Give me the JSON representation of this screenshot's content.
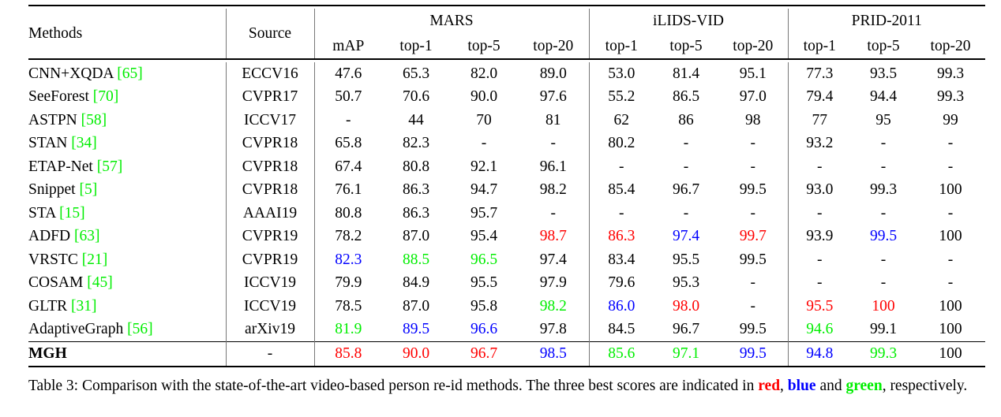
{
  "table": {
    "columns": {
      "methods_label": "Methods",
      "source_label": "Source",
      "groups": [
        {
          "name": "MARS",
          "subcols": [
            "mAP",
            "top-1",
            "top-5",
            "top-20"
          ]
        },
        {
          "name": "iLIDS-VID",
          "subcols": [
            "top-1",
            "top-5",
            "top-20"
          ]
        },
        {
          "name": "PRID-2011",
          "subcols": [
            "top-1",
            "top-5",
            "top-20"
          ]
        }
      ]
    },
    "rows": [
      {
        "method": "CNN+XQDA",
        "cite": "[65]",
        "source": "ECCV16",
        "mars": [
          {
            "v": "47.6",
            "c": ""
          },
          {
            "v": "65.3",
            "c": ""
          },
          {
            "v": "82.0",
            "c": ""
          },
          {
            "v": "89.0",
            "c": ""
          }
        ],
        "ilids": [
          {
            "v": "53.0",
            "c": ""
          },
          {
            "v": "81.4",
            "c": ""
          },
          {
            "v": "95.1",
            "c": ""
          }
        ],
        "prid": [
          {
            "v": "77.3",
            "c": ""
          },
          {
            "v": "93.5",
            "c": ""
          },
          {
            "v": "99.3",
            "c": ""
          }
        ]
      },
      {
        "method": "SeeForest",
        "cite": "[70]",
        "source": "CVPR17",
        "mars": [
          {
            "v": "50.7",
            "c": ""
          },
          {
            "v": "70.6",
            "c": ""
          },
          {
            "v": "90.0",
            "c": ""
          },
          {
            "v": "97.6",
            "c": ""
          }
        ],
        "ilids": [
          {
            "v": "55.2",
            "c": ""
          },
          {
            "v": "86.5",
            "c": ""
          },
          {
            "v": "97.0",
            "c": ""
          }
        ],
        "prid": [
          {
            "v": "79.4",
            "c": ""
          },
          {
            "v": "94.4",
            "c": ""
          },
          {
            "v": "99.3",
            "c": ""
          }
        ]
      },
      {
        "method": "ASTPN",
        "cite": "[58]",
        "source": "ICCV17",
        "mars": [
          {
            "v": "-",
            "c": ""
          },
          {
            "v": "44",
            "c": ""
          },
          {
            "v": "70",
            "c": ""
          },
          {
            "v": "81",
            "c": ""
          }
        ],
        "ilids": [
          {
            "v": "62",
            "c": ""
          },
          {
            "v": "86",
            "c": ""
          },
          {
            "v": "98",
            "c": ""
          }
        ],
        "prid": [
          {
            "v": "77",
            "c": ""
          },
          {
            "v": "95",
            "c": ""
          },
          {
            "v": "99",
            "c": ""
          }
        ]
      },
      {
        "method": "STAN",
        "cite": "[34]",
        "source": "CVPR18",
        "mars": [
          {
            "v": "65.8",
            "c": ""
          },
          {
            "v": "82.3",
            "c": ""
          },
          {
            "v": "-",
            "c": ""
          },
          {
            "v": "-",
            "c": ""
          }
        ],
        "ilids": [
          {
            "v": "80.2",
            "c": ""
          },
          {
            "v": "-",
            "c": ""
          },
          {
            "v": "-",
            "c": ""
          }
        ],
        "prid": [
          {
            "v": "93.2",
            "c": ""
          },
          {
            "v": "-",
            "c": ""
          },
          {
            "v": "-",
            "c": ""
          }
        ]
      },
      {
        "method": "ETAP-Net",
        "cite": "[57]",
        "source": "CVPR18",
        "mars": [
          {
            "v": "67.4",
            "c": ""
          },
          {
            "v": "80.8",
            "c": ""
          },
          {
            "v": "92.1",
            "c": ""
          },
          {
            "v": "96.1",
            "c": ""
          }
        ],
        "ilids": [
          {
            "v": "-",
            "c": ""
          },
          {
            "v": "-",
            "c": ""
          },
          {
            "v": "-",
            "c": ""
          }
        ],
        "prid": [
          {
            "v": "-",
            "c": ""
          },
          {
            "v": "-",
            "c": ""
          },
          {
            "v": "-",
            "c": ""
          }
        ]
      },
      {
        "method": "Snippet",
        "cite": "[5]",
        "source": "CVPR18",
        "mars": [
          {
            "v": "76.1",
            "c": ""
          },
          {
            "v": "86.3",
            "c": ""
          },
          {
            "v": "94.7",
            "c": ""
          },
          {
            "v": "98.2",
            "c": ""
          }
        ],
        "ilids": [
          {
            "v": "85.4",
            "c": ""
          },
          {
            "v": "96.7",
            "c": ""
          },
          {
            "v": "99.5",
            "c": ""
          }
        ],
        "prid": [
          {
            "v": "93.0",
            "c": ""
          },
          {
            "v": "99.3",
            "c": ""
          },
          {
            "v": "100",
            "c": ""
          }
        ]
      },
      {
        "method": "STA",
        "cite": "[15]",
        "source": "AAAI19",
        "mars": [
          {
            "v": "80.8",
            "c": ""
          },
          {
            "v": "86.3",
            "c": ""
          },
          {
            "v": "95.7",
            "c": ""
          },
          {
            "v": "-",
            "c": ""
          }
        ],
        "ilids": [
          {
            "v": "-",
            "c": ""
          },
          {
            "v": "-",
            "c": ""
          },
          {
            "v": "-",
            "c": ""
          }
        ],
        "prid": [
          {
            "v": "-",
            "c": ""
          },
          {
            "v": "-",
            "c": ""
          },
          {
            "v": "-",
            "c": ""
          }
        ]
      },
      {
        "method": "ADFD",
        "cite": "[63]",
        "source": "CVPR19",
        "mars": [
          {
            "v": "78.2",
            "c": ""
          },
          {
            "v": "87.0",
            "c": ""
          },
          {
            "v": "95.4",
            "c": ""
          },
          {
            "v": "98.7",
            "c": "red"
          }
        ],
        "ilids": [
          {
            "v": "86.3",
            "c": "red"
          },
          {
            "v": "97.4",
            "c": "blue"
          },
          {
            "v": "99.7",
            "c": "red"
          }
        ],
        "prid": [
          {
            "v": "93.9",
            "c": ""
          },
          {
            "v": "99.5",
            "c": "blue"
          },
          {
            "v": "100",
            "c": ""
          }
        ]
      },
      {
        "method": "VRSTC",
        "cite": "[21]",
        "source": "CVPR19",
        "mars": [
          {
            "v": "82.3",
            "c": "blue"
          },
          {
            "v": "88.5",
            "c": "green"
          },
          {
            "v": "96.5",
            "c": "green"
          },
          {
            "v": "97.4",
            "c": ""
          }
        ],
        "ilids": [
          {
            "v": "83.4",
            "c": ""
          },
          {
            "v": "95.5",
            "c": ""
          },
          {
            "v": "99.5",
            "c": ""
          }
        ],
        "prid": [
          {
            "v": "-",
            "c": ""
          },
          {
            "v": "-",
            "c": ""
          },
          {
            "v": "-",
            "c": ""
          }
        ]
      },
      {
        "method": "COSAM",
        "cite": "[45]",
        "source": "ICCV19",
        "mars": [
          {
            "v": "79.9",
            "c": ""
          },
          {
            "v": "84.9",
            "c": ""
          },
          {
            "v": "95.5",
            "c": ""
          },
          {
            "v": "97.9",
            "c": ""
          }
        ],
        "ilids": [
          {
            "v": "79.6",
            "c": ""
          },
          {
            "v": "95.3",
            "c": ""
          },
          {
            "v": "-",
            "c": ""
          }
        ],
        "prid": [
          {
            "v": "-",
            "c": ""
          },
          {
            "v": "-",
            "c": ""
          },
          {
            "v": "-",
            "c": ""
          }
        ]
      },
      {
        "method": "GLTR",
        "cite": "[31]",
        "source": "ICCV19",
        "mars": [
          {
            "v": "78.5",
            "c": ""
          },
          {
            "v": "87.0",
            "c": ""
          },
          {
            "v": "95.8",
            "c": ""
          },
          {
            "v": "98.2",
            "c": "green"
          }
        ],
        "ilids": [
          {
            "v": "86.0",
            "c": "blue"
          },
          {
            "v": "98.0",
            "c": "red"
          },
          {
            "v": "-",
            "c": ""
          }
        ],
        "prid": [
          {
            "v": "95.5",
            "c": "red"
          },
          {
            "v": "100",
            "c": "red"
          },
          {
            "v": "100",
            "c": ""
          }
        ]
      },
      {
        "method": "AdaptiveGraph",
        "cite": "[56]",
        "source": "arXiv19",
        "mars": [
          {
            "v": "81.9",
            "c": "green"
          },
          {
            "v": "89.5",
            "c": "blue"
          },
          {
            "v": "96.6",
            "c": "blue"
          },
          {
            "v": "97.8",
            "c": ""
          }
        ],
        "ilids": [
          {
            "v": "84.5",
            "c": ""
          },
          {
            "v": "96.7",
            "c": ""
          },
          {
            "v": "99.5",
            "c": ""
          }
        ],
        "prid": [
          {
            "v": "94.6",
            "c": "green"
          },
          {
            "v": "99.1",
            "c": ""
          },
          {
            "v": "100",
            "c": ""
          }
        ]
      },
      {
        "method": "MGH",
        "cite": "",
        "method_bold": true,
        "source": "-",
        "mars": [
          {
            "v": "85.8",
            "c": "red"
          },
          {
            "v": "90.0",
            "c": "red"
          },
          {
            "v": "96.7",
            "c": "red"
          },
          {
            "v": "98.5",
            "c": "blue"
          }
        ],
        "ilids": [
          {
            "v": "85.6",
            "c": "green"
          },
          {
            "v": "97.1",
            "c": "green"
          },
          {
            "v": "99.5",
            "c": "blue"
          }
        ],
        "prid": [
          {
            "v": "94.8",
            "c": "blue"
          },
          {
            "v": "99.3",
            "c": "green"
          },
          {
            "v": "100",
            "c": ""
          }
        ]
      }
    ]
  },
  "caption": {
    "prefix": "Table 3: Comparison with the state-of-the-art video-based person re-id methods. The three best scores are indicated in ",
    "red_word": "red",
    "mid1": ", ",
    "blue_word": "blue",
    "mid2": " and ",
    "green_word": "green",
    "suffix": ", respectively."
  },
  "colors": {
    "red": "#FF0000",
    "blue": "#0000FF",
    "green": "#00EE00",
    "text": "#000000",
    "rule": "#000000"
  }
}
